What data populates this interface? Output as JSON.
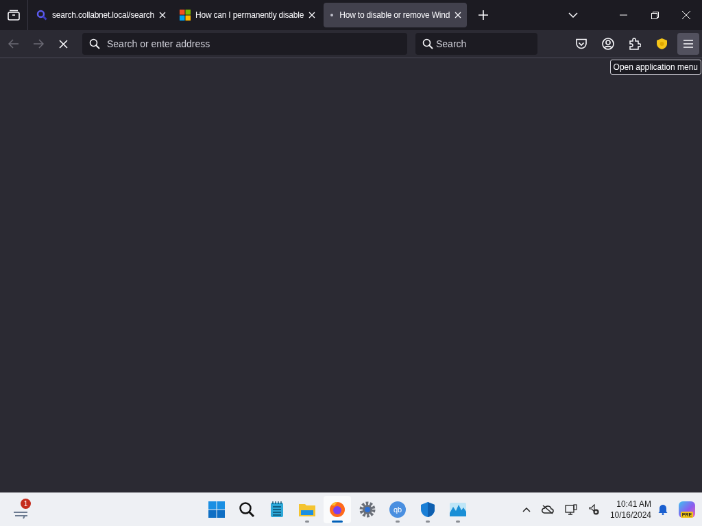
{
  "tabs": [
    {
      "kind": "search",
      "title": "search.collabnet.local/search",
      "selected": false
    },
    {
      "kind": "windows",
      "title": "How can I permanently disable",
      "selected": false
    },
    {
      "kind": "loading",
      "title": "How to disable or remove Wind",
      "selected": true
    }
  ],
  "toolbar": {
    "back_disabled": true,
    "forward_disabled": true,
    "address_placeholder": "Search or enter address",
    "search_placeholder": "Search",
    "menu_selected": true
  },
  "tooltip": "Open application menu",
  "taskbar": {
    "widget_badge": "1",
    "apps": [
      {
        "kind": "start",
        "running": false,
        "selected": false
      },
      {
        "kind": "search",
        "running": false,
        "selected": false
      },
      {
        "kind": "notepad",
        "running": false,
        "selected": false
      },
      {
        "kind": "explorer",
        "running": true,
        "selected": false
      },
      {
        "kind": "firefox",
        "running": true,
        "selected": true
      },
      {
        "kind": "settings",
        "running": false,
        "selected": false
      },
      {
        "kind": "qbittorrent",
        "label": "qb",
        "running": true,
        "selected": false
      },
      {
        "kind": "defender",
        "running": true,
        "selected": false
      },
      {
        "kind": "monitor",
        "running": true,
        "selected": false
      }
    ],
    "time": "10:41 AM",
    "date": "10/16/2024",
    "copilot_label": "PRE"
  }
}
